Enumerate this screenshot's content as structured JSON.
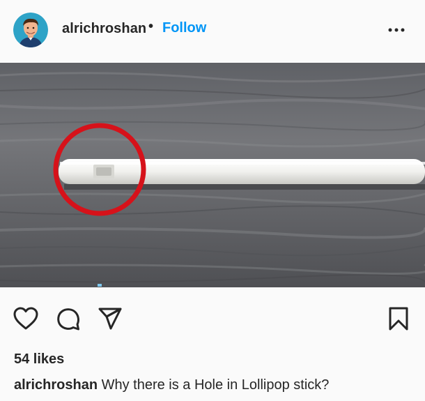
{
  "post": {
    "username": "alrichroshan",
    "separator": "•",
    "follow_label": "Follow",
    "more_icon": "more-horizontal-icon",
    "likes_text": "54 likes",
    "caption_user": "alrichroshan",
    "caption_text": "Why there is a Hole in Lollipop stick?"
  },
  "actions": {
    "icons": [
      "heart-icon",
      "comment-icon",
      "share-icon",
      "bookmark-icon"
    ]
  },
  "colors": {
    "accent": "#0095f6",
    "text": "#262626",
    "background": "#fafafa",
    "annotation_circle": "#d6121a"
  }
}
